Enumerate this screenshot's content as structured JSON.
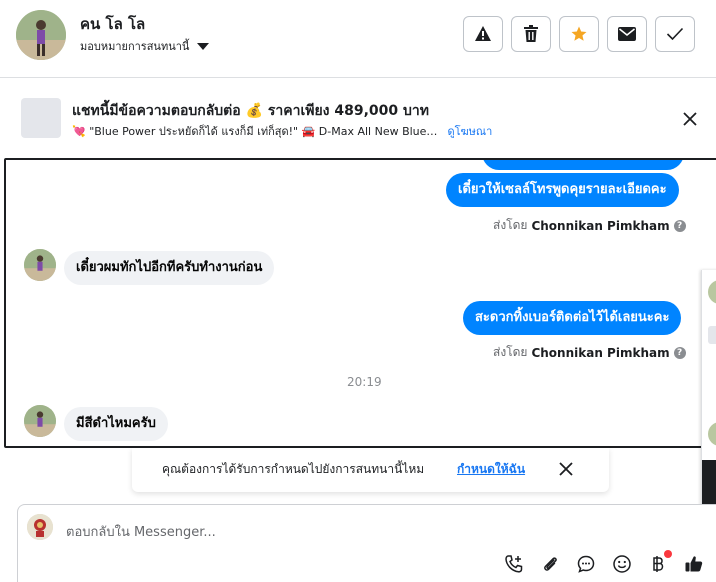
{
  "header": {
    "name": "คน โล โล",
    "assign_label": "มอบหมายการสนทนานี้"
  },
  "ad_banner": {
    "title": "แชทนี้มีข้อความตอบกลับต่อ 💰 ราคาเพียง 489,000 บาท",
    "subtitle": "💘 \"Blue Power ประหยัดก็ได้ แรงก็มี เท่ก็สุด!\" 🚘 D-Max All New Blue…",
    "link": "ดูโฆษณา"
  },
  "messages": {
    "out_1": "เดี๋ยวให้เซลล์โทรพูดคุยรายละเอียดคะ",
    "in_1": "เดี๋ยวผมทักไปอีกทีครับทำงานก่อน",
    "out_2": "สะดวกทิ้งเบอร์ติดต่อไว้ได้เลยนะคะ",
    "time_separator": "20:19",
    "in_2": "มีสีดำไหมครับ"
  },
  "sent_by": {
    "prefix": "ส่งโดย",
    "agent": "Chonnikan Pimkham"
  },
  "assign_prompt": {
    "text": "คุณต้องการได้รับการกำหนดไปยังการสนทนานี้ไหม",
    "link": "กำหนดให้ฉัน"
  },
  "composer": {
    "placeholder": "ตอบกลับใน Messenger..."
  },
  "colors": {
    "messenger_blue": "#0084ff",
    "link_blue": "#1877f2",
    "star_orange": "#f5a623",
    "notify_red": "#fa383e"
  },
  "icons": {
    "actions": [
      "warning-icon",
      "trash-icon",
      "star-icon",
      "envelope-icon",
      "check-icon"
    ],
    "tools": [
      "phone-add-icon",
      "paperclip-icon",
      "chat-bubble-icon",
      "smiley-icon",
      "baht-icon",
      "thumbs-up-icon"
    ]
  }
}
